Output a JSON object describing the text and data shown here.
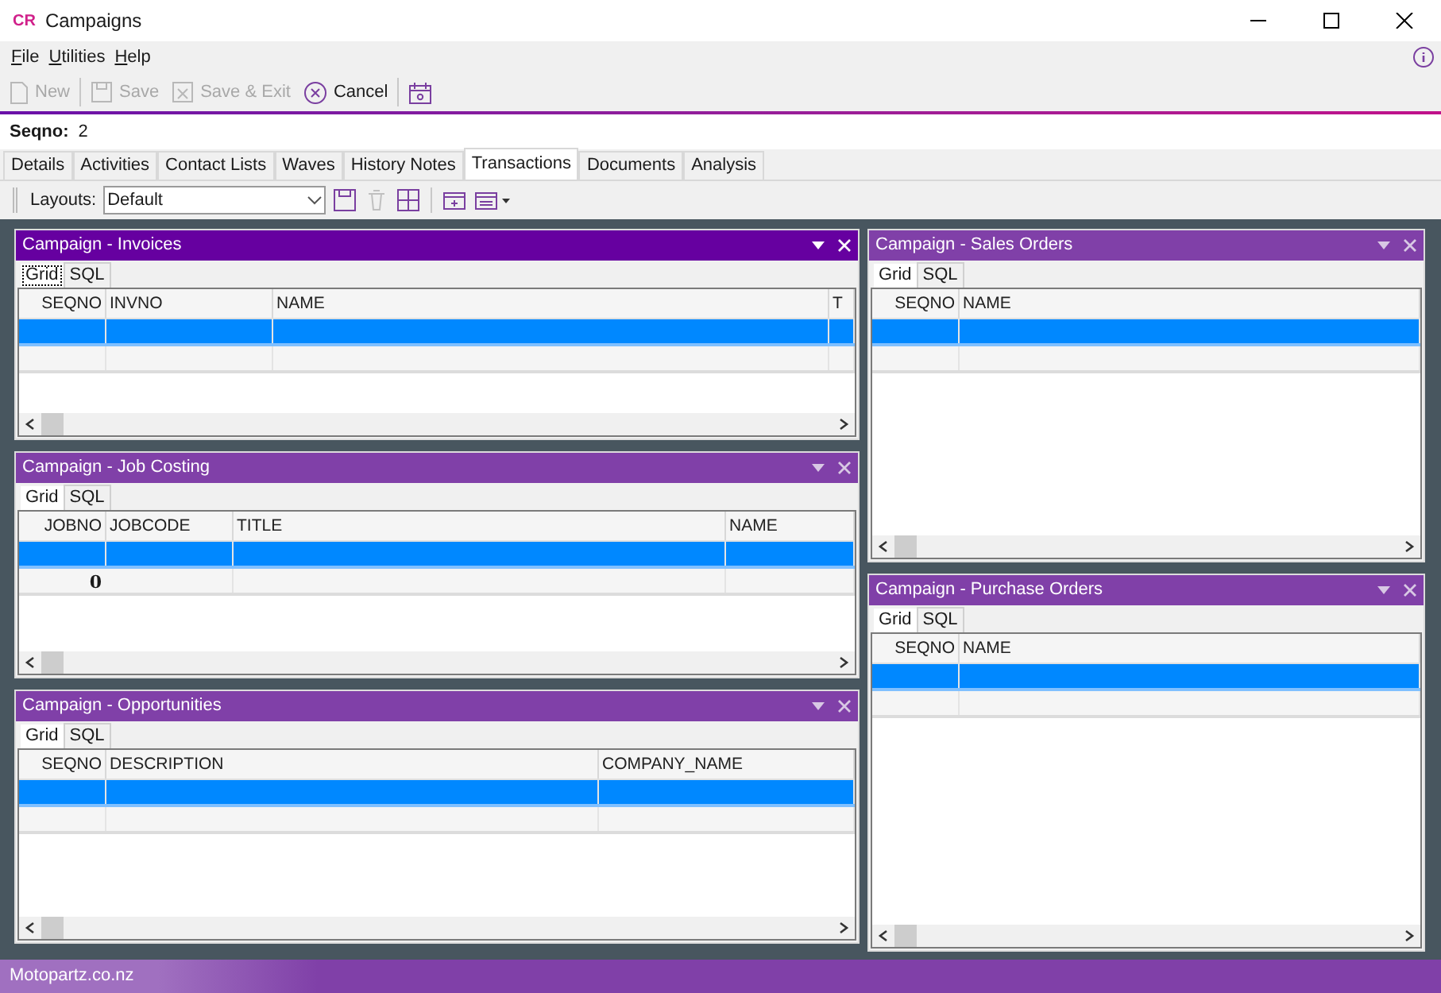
{
  "window": {
    "logo": "CR",
    "title": "Campaigns"
  },
  "menu": [
    {
      "label": "File"
    },
    {
      "label": "Utilities"
    },
    {
      "label": "Help"
    }
  ],
  "toolbar": [
    {
      "kind": "new",
      "label": "New",
      "disabled": true
    },
    {
      "kind": "save",
      "label": "Save",
      "disabled": true
    },
    {
      "kind": "save_exit",
      "label": "Save & Exit",
      "disabled": true
    },
    {
      "kind": "cancel",
      "label": "Cancel",
      "disabled": false
    },
    {
      "kind": "calendar",
      "disabled": false
    }
  ],
  "record": {
    "label": "Seqno:",
    "value": "2"
  },
  "tabs": [
    {
      "label": "Details",
      "selected": false
    },
    {
      "label": "Activities",
      "selected": false
    },
    {
      "label": "Contact Lists",
      "selected": false
    },
    {
      "label": "Waves",
      "selected": false
    },
    {
      "label": "History Notes",
      "selected": false
    },
    {
      "label": "Transactions",
      "selected": true
    },
    {
      "label": "Documents",
      "selected": false
    },
    {
      "label": "Analysis",
      "selected": false
    }
  ],
  "layouts": {
    "label": "Layouts:",
    "value": "Default"
  },
  "left_panels": [
    {
      "title": "Campaign - Invoices",
      "active": true,
      "tabs": [
        {
          "label": "Grid",
          "selected": true
        },
        {
          "label": "SQL",
          "selected": false
        }
      ],
      "columns": [
        "SEQNO",
        "INVNO",
        "NAME",
        "T"
      ],
      "rows": [
        {
          "selected": true,
          "cells": [
            "",
            "",
            "",
            ""
          ]
        },
        {
          "selected": false,
          "cells": [
            "",
            "",
            "",
            ""
          ]
        }
      ]
    },
    {
      "title": "Campaign - Job Costing",
      "active": false,
      "tabs": [
        {
          "label": "Grid",
          "selected": true
        },
        {
          "label": "SQL",
          "selected": false
        }
      ],
      "columns": [
        "JOBNO",
        "JOBCODE",
        "TITLE",
        "NAME"
      ],
      "rows": [
        {
          "selected": true,
          "cells": [
            "",
            "",
            "",
            ""
          ]
        },
        {
          "selected": false,
          "cells": [
            "0",
            "",
            "",
            ""
          ]
        }
      ]
    },
    {
      "title": "Campaign - Opportunities",
      "active": false,
      "tabs": [
        {
          "label": "Grid",
          "selected": true
        },
        {
          "label": "SQL",
          "selected": false
        }
      ],
      "columns": [
        "SEQNO",
        "DESCRIPTION",
        "COMPANY_NAME"
      ],
      "rows": [
        {
          "selected": true,
          "cells": [
            "",
            "",
            ""
          ]
        },
        {
          "selected": false,
          "cells": [
            "",
            "",
            ""
          ]
        }
      ]
    }
  ],
  "right_panels": [
    {
      "title": "Campaign - Sales Orders",
      "active": false,
      "tabs": [
        {
          "label": "Grid",
          "selected": true
        },
        {
          "label": "SQL",
          "selected": false
        }
      ],
      "columns": [
        "SEQNO",
        "NAME"
      ],
      "rows": [
        {
          "selected": true,
          "cells": [
            "",
            ""
          ]
        },
        {
          "selected": false,
          "cells": [
            "",
            ""
          ]
        }
      ]
    },
    {
      "title": "Campaign - Purchase Orders",
      "active": false,
      "tabs": [
        {
          "label": "Grid",
          "selected": true
        },
        {
          "label": "SQL",
          "selected": false
        }
      ],
      "columns": [
        "SEQNO",
        "NAME"
      ],
      "rows": [
        {
          "selected": true,
          "cells": [
            "",
            ""
          ]
        },
        {
          "selected": false,
          "cells": [
            "",
            ""
          ]
        }
      ]
    }
  ],
  "status_bar": {
    "text": "Motopartz.co.nz"
  }
}
